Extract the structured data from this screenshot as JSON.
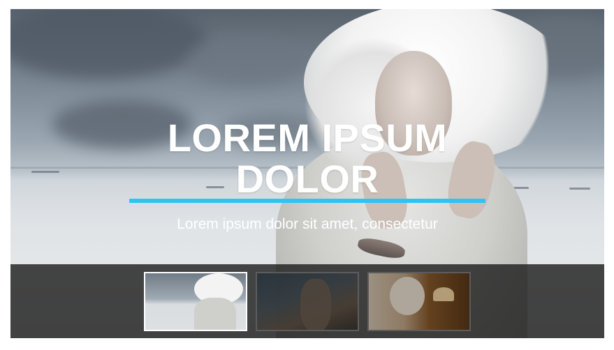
{
  "slider": {
    "title_line1": "LOREM IPSUM",
    "title_line2": "DOLOR",
    "subtitle": "Lorem ipsum dolor sit amet, consectetur",
    "accent_color": "#2ec4f1"
  },
  "thumbnails": [
    {
      "name": "slide-1",
      "active": true
    },
    {
      "name": "slide-2",
      "active": false
    },
    {
      "name": "slide-3",
      "active": false
    }
  ]
}
